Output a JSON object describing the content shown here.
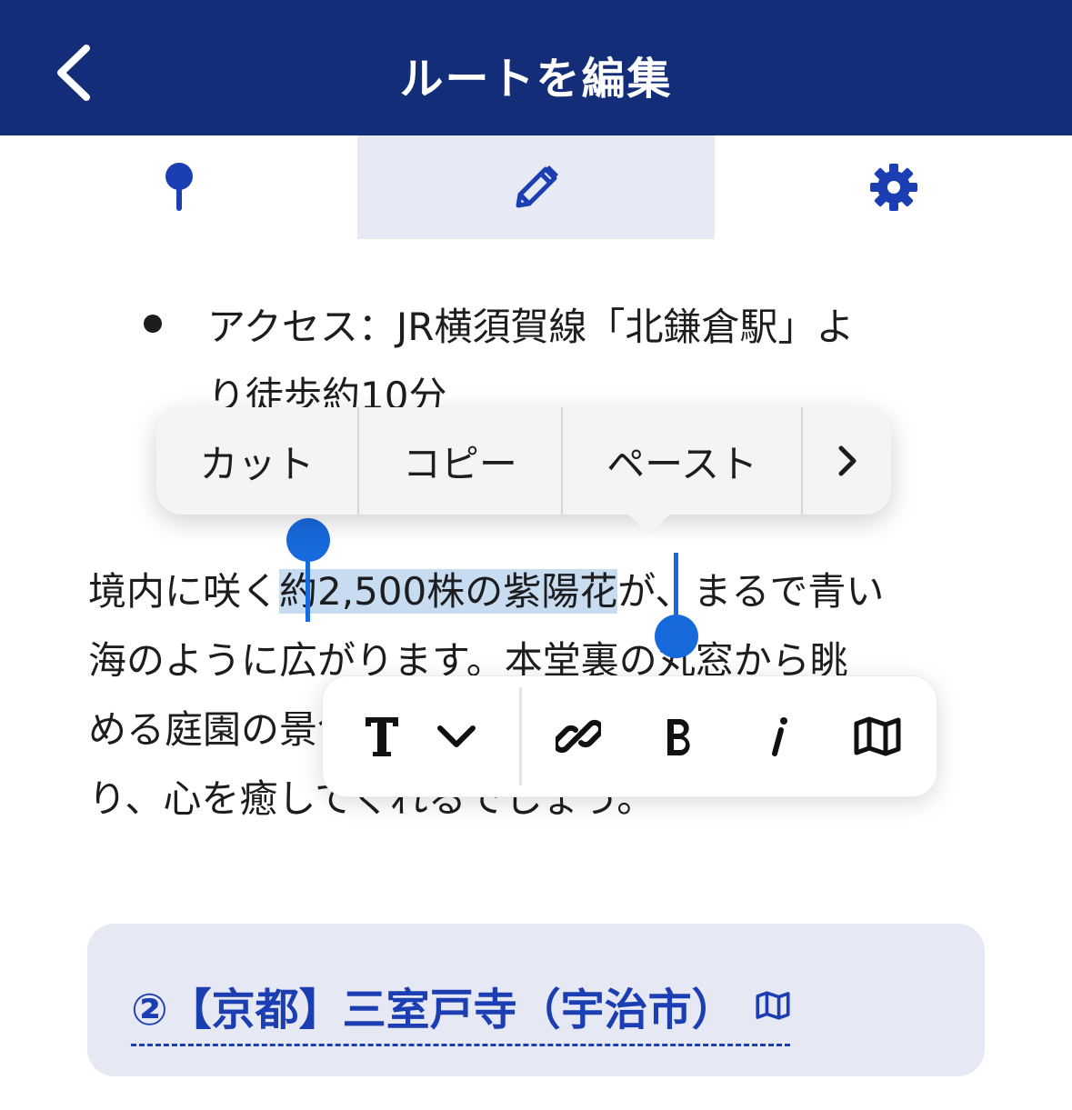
{
  "header": {
    "title": "ルートを編集",
    "background": "#142d79"
  },
  "tabs": [
    {
      "icon": "map-pin-icon",
      "active": false
    },
    {
      "icon": "pencil-icon",
      "active": true
    },
    {
      "icon": "gear-icon",
      "active": false
    }
  ],
  "content": {
    "bullet": {
      "line1": "アクセス：JR横須賀線「北鎌倉駅」よ",
      "line2": "り徒歩約10分"
    },
    "paragraph": {
      "line1_before": "境内に咲く",
      "line1_selected": "約2,500株の紫陽花",
      "line1_after": "が、まるで青い",
      "line2": "海のように広がります。本堂裏の丸窓から眺",
      "line3": "める庭園の景色は絵画のような美しさがあ",
      "line4": "り、心を癒してくれるでしょう。"
    }
  },
  "context_menu": {
    "items": [
      "カット",
      "コピー",
      "ペースト"
    ],
    "more": "›"
  },
  "format_toolbar": {
    "icons": [
      "text-style-icon",
      "chevron-down-icon",
      "link-icon",
      "bold-icon",
      "italic-icon",
      "map-icon"
    ]
  },
  "card": {
    "title": "②【京都】三室戸寺（宇治市）",
    "color": "#1c3eb3"
  },
  "accent": "#1769dc"
}
